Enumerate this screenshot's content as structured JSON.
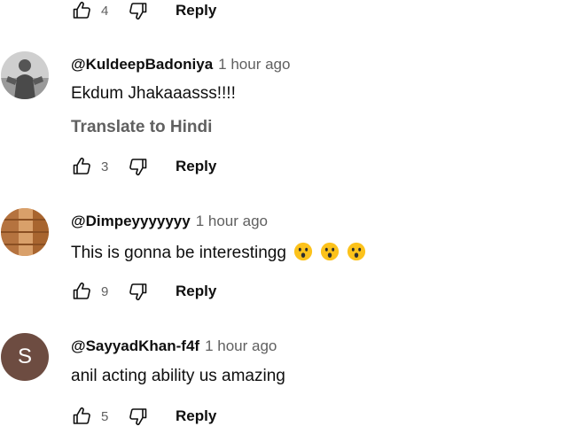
{
  "top_actions": {
    "like_count": "4",
    "reply_label": "Reply"
  },
  "comments": [
    {
      "author": "@KuldeepBadoniya",
      "time": "1 hour ago",
      "text": "Ekdum Jhakaaasss!!!!",
      "translate": "Translate to Hindi",
      "like_count": "3",
      "reply_label": "Reply",
      "avatar": "photo-avatar"
    },
    {
      "author": "@Dimpeyyyyyyy",
      "time": "1 hour ago",
      "text": "This is gonna be interestingg",
      "emojis": [
        "astonished-face-emoji",
        "astonished-face-emoji",
        "astonished-face-emoji"
      ],
      "like_count": "9",
      "reply_label": "Reply",
      "avatar": "bricks-avatar"
    },
    {
      "author": "@SayyadKhan-f4f",
      "time": "1 hour ago",
      "text": "anil acting ability us amazing",
      "like_count": "5",
      "reply_label": "Reply",
      "avatar_initial": "S",
      "avatar_color": "#6d4c41"
    }
  ],
  "colors": {
    "text": "#0f0f0f",
    "secondary": "#606060",
    "background": "#ffffff"
  }
}
